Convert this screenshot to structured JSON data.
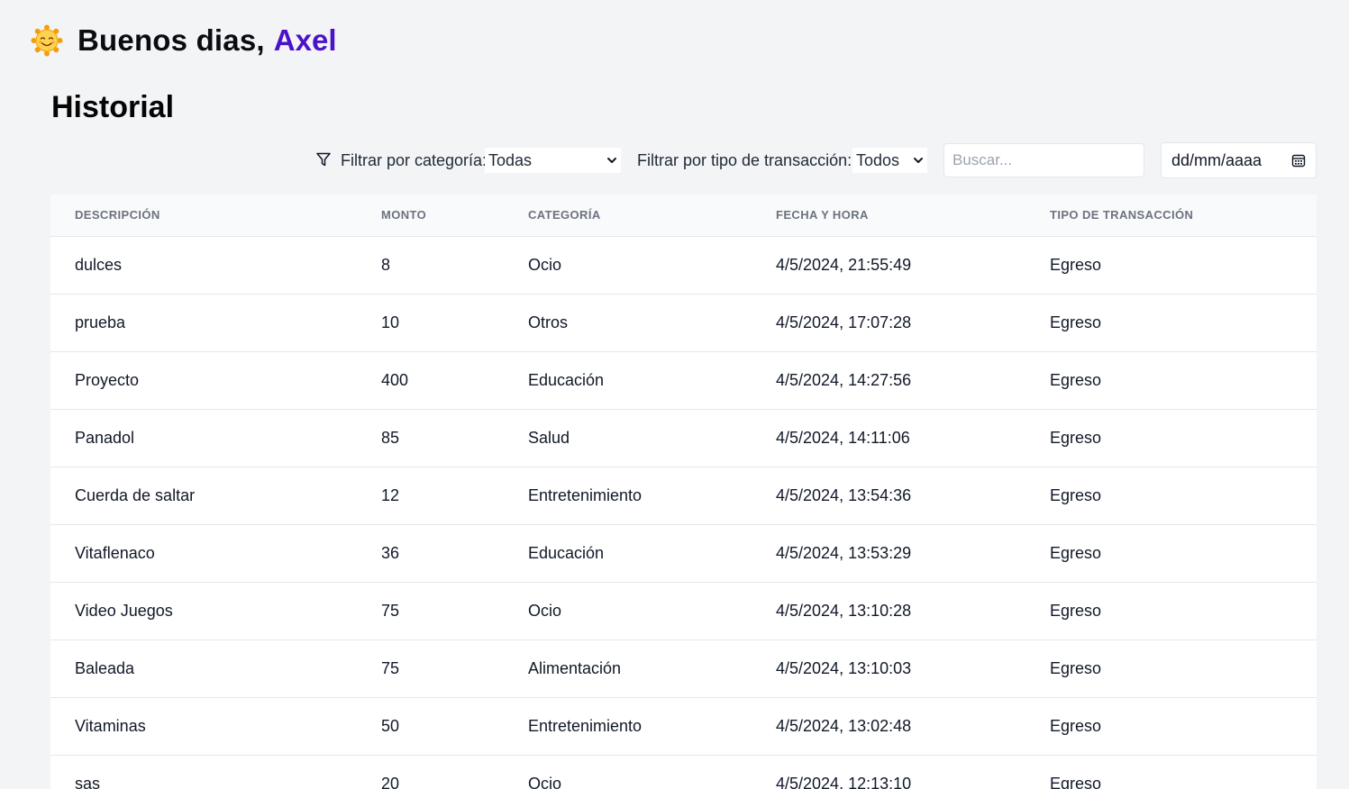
{
  "header": {
    "greeting": "Buenos dias,",
    "user_name": "Axel",
    "icon": "smiling-sun-icon",
    "accent_color": "#4c12c9"
  },
  "page": {
    "title": "Historial"
  },
  "filters": {
    "category_label": "Filtrar por categoría:",
    "category_value": "Todas",
    "type_label": "Filtrar por tipo de transacción:",
    "type_value": "Todos",
    "search_placeholder": "Buscar...",
    "date_placeholder": "dd/mm/aaaa"
  },
  "table": {
    "headers": [
      "DESCRIPCIÓN",
      "MONTO",
      "CATEGORÍA",
      "FECHA Y HORA",
      "TIPO DE TRANSACCIÓN"
    ],
    "rows": [
      [
        "dulces",
        "8",
        "Ocio",
        "4/5/2024, 21:55:49",
        "Egreso"
      ],
      [
        "prueba",
        "10",
        "Otros",
        "4/5/2024, 17:07:28",
        "Egreso"
      ],
      [
        "Proyecto",
        "400",
        "Educación",
        "4/5/2024, 14:27:56",
        "Egreso"
      ],
      [
        "Panadol",
        "85",
        "Salud",
        "4/5/2024, 14:11:06",
        "Egreso"
      ],
      [
        "Cuerda de saltar",
        "12",
        "Entretenimiento",
        "4/5/2024, 13:54:36",
        "Egreso"
      ],
      [
        "Vitaflenaco",
        "36",
        "Educación",
        "4/5/2024, 13:53:29",
        "Egreso"
      ],
      [
        "Video Juegos",
        "75",
        "Ocio",
        "4/5/2024, 13:10:28",
        "Egreso"
      ],
      [
        "Baleada",
        "75",
        "Alimentación",
        "4/5/2024, 13:10:03",
        "Egreso"
      ],
      [
        "Vitaminas",
        "50",
        "Entretenimiento",
        "4/5/2024, 13:02:48",
        "Egreso"
      ],
      [
        "sas",
        "20",
        "Ocio",
        "4/5/2024, 12:13:10",
        "Egreso"
      ]
    ]
  }
}
